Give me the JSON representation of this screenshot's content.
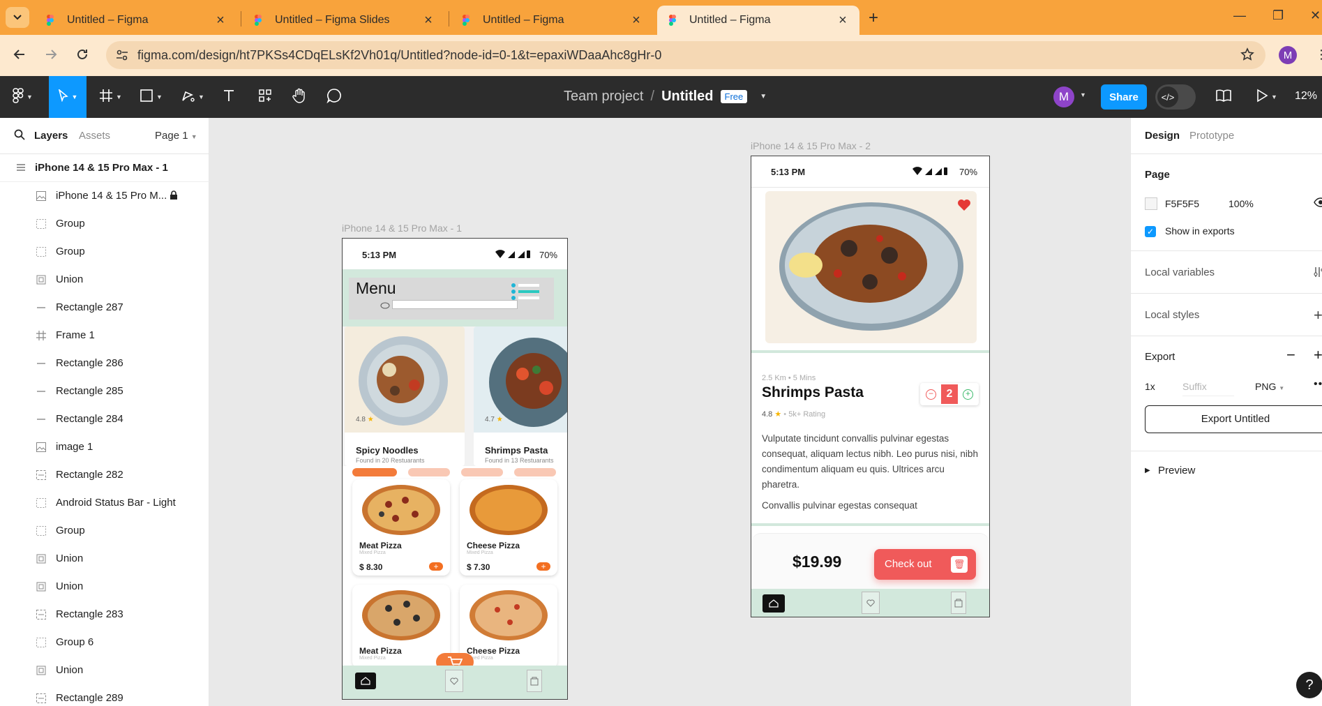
{
  "browser": {
    "tabs": [
      {
        "title": "Untitled – Figma",
        "active": false
      },
      {
        "title": "Untitled – Figma Slides",
        "active": false
      },
      {
        "title": "Untitled – Figma",
        "active": false
      },
      {
        "title": "Untitled – Figma",
        "active": true
      }
    ],
    "url": "figma.com/design/ht7PKSs4CDqELsKf2Vh01q/Untitled?node-id=0-1&t=epaxiWDaaAhc8gHr-0",
    "profile_initial": "M"
  },
  "toolbar": {
    "team": "Team project",
    "file": "Untitled",
    "plan_badge": "Free",
    "user_initial": "M",
    "share_label": "Share",
    "zoom": "12%"
  },
  "left_panel": {
    "tabs": {
      "layers": "Layers",
      "assets": "Assets",
      "page": "Page 1"
    },
    "root": "iPhone 14 & 15 Pro Max - 1",
    "layers": [
      {
        "name": "iPhone 14 & 15 Pro M...",
        "icon": "image-icon",
        "locked": true
      },
      {
        "name": "Group",
        "icon": "group-icon"
      },
      {
        "name": "Group",
        "icon": "group-icon"
      },
      {
        "name": "Union",
        "icon": "union-icon"
      },
      {
        "name": "Rectangle 287",
        "icon": "line-icon"
      },
      {
        "name": "Frame 1",
        "icon": "frame-icon"
      },
      {
        "name": "Rectangle 286",
        "icon": "line-icon"
      },
      {
        "name": "Rectangle 285",
        "icon": "line-icon"
      },
      {
        "name": "Rectangle 284",
        "icon": "line-icon"
      },
      {
        "name": "image 1",
        "icon": "image-icon"
      },
      {
        "name": "Rectangle 282",
        "icon": "rect-icon"
      },
      {
        "name": "Android Status Bar - Light",
        "icon": "group-icon"
      },
      {
        "name": "Group",
        "icon": "group-icon"
      },
      {
        "name": "Union",
        "icon": "union-icon"
      },
      {
        "name": "Union",
        "icon": "union-icon"
      },
      {
        "name": "Rectangle 283",
        "icon": "rect-icon"
      },
      {
        "name": "Group 6",
        "icon": "group-icon"
      },
      {
        "name": "Union",
        "icon": "union-icon"
      },
      {
        "name": "Rectangle 289",
        "icon": "rect-icon"
      }
    ]
  },
  "canvas": {
    "frame1_label": "iPhone 14 & 15 Pro Max - 1",
    "frame2_label": "iPhone 14 & 15 Pro Max - 2",
    "phone1": {
      "time": "5:13 PM",
      "battery": "70%",
      "menu_title": "Menu",
      "cards": [
        {
          "name": "Spicy Noodles",
          "found": "Found in 20 Restuarants",
          "rating": "4.8"
        },
        {
          "name": "Shrimps Pasta",
          "found": "Found in 13 Restuarants",
          "rating": "4.7"
        }
      ],
      "pizzas": [
        {
          "name": "Meat Pizza",
          "sub": "Mixed Pizza",
          "price": "$ 8.30"
        },
        {
          "name": "Cheese Pizza",
          "sub": "Mixed Pizza",
          "price": "$ 7.30"
        },
        {
          "name": "Meat Pizza",
          "sub": "Mixed Pizza"
        },
        {
          "name": "Cheese Pizza",
          "sub": "Mixed Pizza"
        }
      ]
    },
    "phone2": {
      "time": "5:13 PM",
      "battery": "70%",
      "meta": "2.5 Km  •  5 Mins",
      "title": "Shrimps Pasta",
      "rating": "4.8",
      "rating_count": "5k+ Rating",
      "quantity": "2",
      "description": "Vulputate tincidunt convallis pulvinar egestas consequat, aliquam lectus nibh. Leo purus nisi, nibh condimentum aliquam eu quis. Ultrices arcu pharetra.",
      "description2": "Convallis pulvinar egestas consequat",
      "price": "$19.99",
      "checkout_label": "Check out"
    }
  },
  "right_panel": {
    "tabs": {
      "design": "Design",
      "prototype": "Prototype"
    },
    "page_heading": "Page",
    "page_color": "F5F5F5",
    "page_opacity": "100%",
    "show_in_exports": "Show in exports",
    "local_variables": "Local variables",
    "local_styles": "Local styles",
    "export_heading": "Export",
    "export_scale": "1x",
    "export_suffix_placeholder": "Suffix",
    "export_format": "PNG",
    "export_button": "Export Untitled",
    "preview": "Preview"
  },
  "colors": {
    "browser_tabbar": "#f8a33c",
    "figma_toolbar": "#2c2c2c",
    "accent_blue": "#0d99ff",
    "app_green": "#d2e8dc",
    "checkout_red": "#f05a5a"
  }
}
